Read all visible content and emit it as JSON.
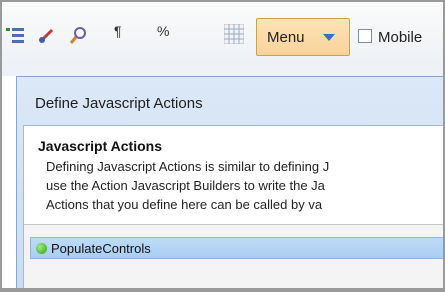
{
  "toolbar": {
    "icons": [
      "list-indent-icon",
      "edit-brush-icon",
      "zoom-search-icon",
      "pilcrow-icon",
      "percent-icon",
      "grid-icon"
    ],
    "pilcrow": "¶",
    "percent": "%",
    "menu_label": "Menu",
    "mobile_label": "Mobile"
  },
  "dialog": {
    "title": "Define Javascript Actions",
    "section_title": "Javascript Actions",
    "description_lines": [
      "Defining Javascript Actions is similar to defining J",
      "use the Action Javascript Builders to write the Ja",
      "Actions that you define here can be called by va"
    ],
    "actions": [
      {
        "label": "PopulateControls",
        "selected": true
      }
    ]
  },
  "colors": {
    "menu_accent": "#f9d29a",
    "selection": "#bfdcf7",
    "status_green": "#2f9a1f"
  }
}
